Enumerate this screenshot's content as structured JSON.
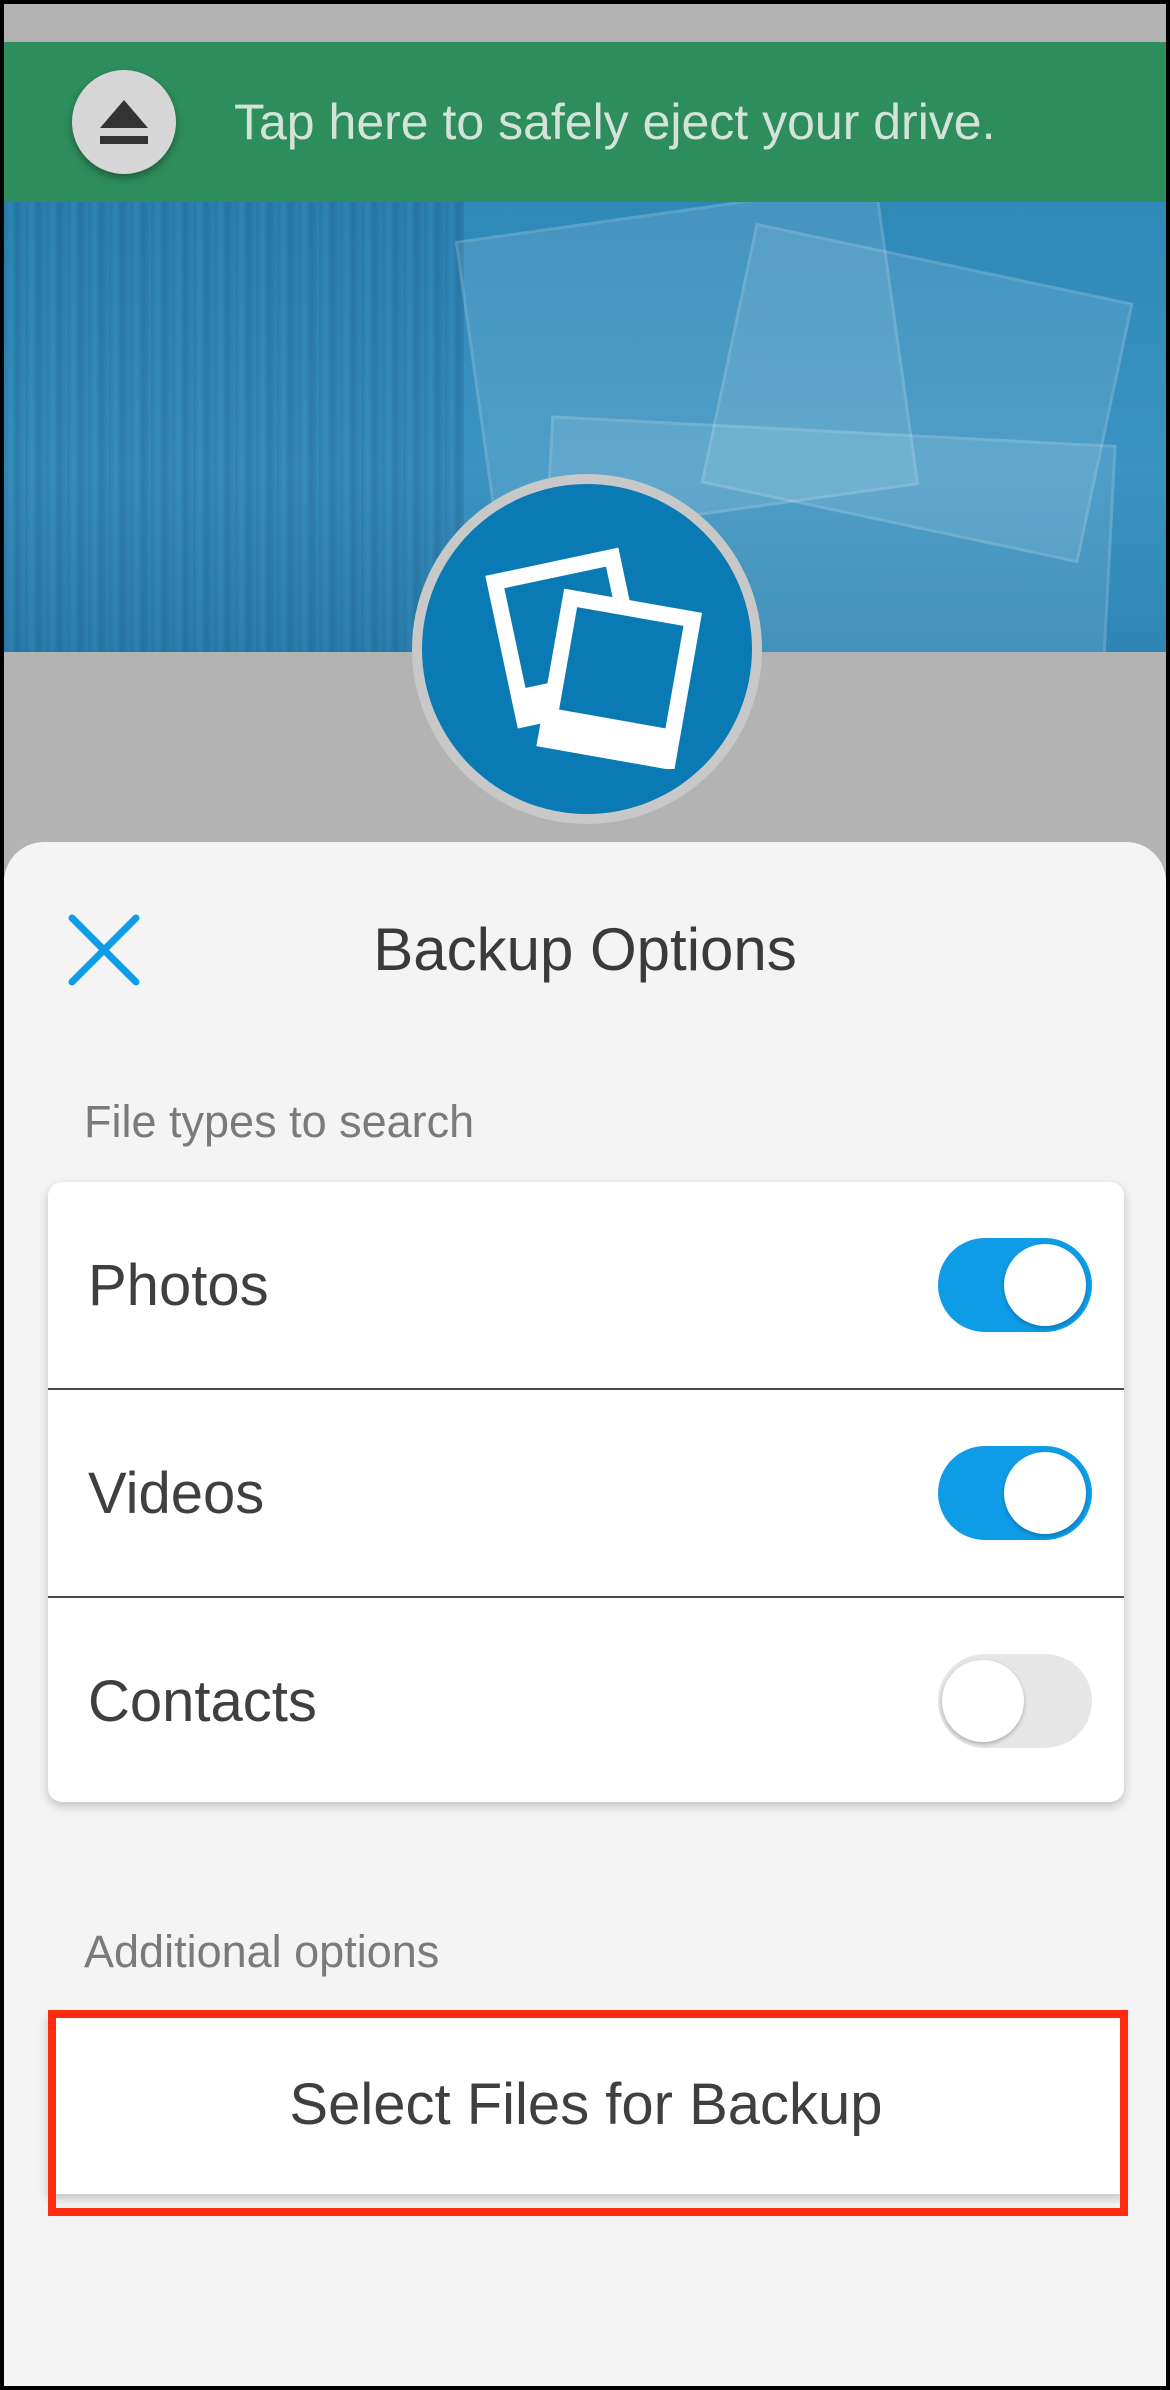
{
  "banner": {
    "text": "Tap here to safely eject your drive.",
    "color": "#2e8d5c"
  },
  "sheet": {
    "title": "Backup Options",
    "close_icon": "close-icon",
    "accent": "#0f9ce6"
  },
  "file_types": {
    "label": "File types to search",
    "items": [
      {
        "label": "Photos",
        "enabled": true
      },
      {
        "label": "Videos",
        "enabled": true
      },
      {
        "label": "Contacts",
        "enabled": false
      }
    ]
  },
  "additional": {
    "label": "Additional options",
    "button_label": "Select Files for Backup",
    "highlight_color": "#ff2a0f"
  }
}
